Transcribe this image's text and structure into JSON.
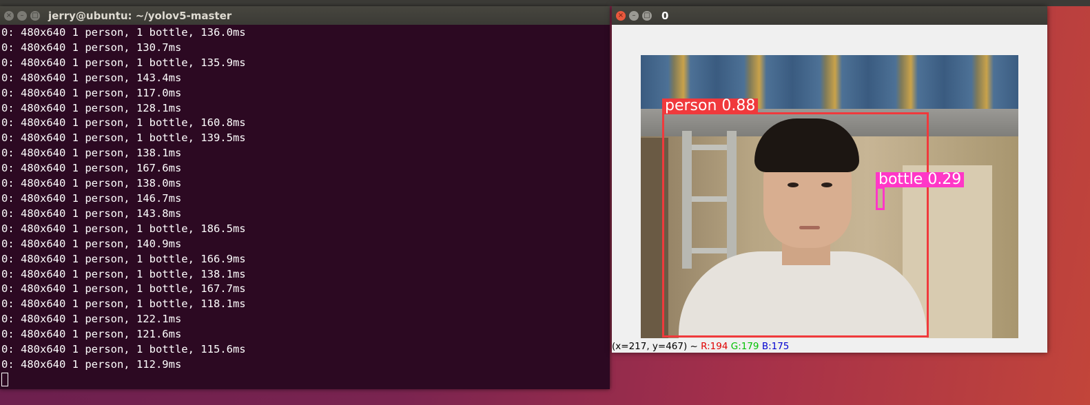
{
  "terminal": {
    "title": "jerry@ubuntu: ~/yolov5-master",
    "lines": [
      "0: 480x640 1 person, 1 bottle, 136.0ms",
      "0: 480x640 1 person, 130.7ms",
      "0: 480x640 1 person, 1 bottle, 135.9ms",
      "0: 480x640 1 person, 143.4ms",
      "0: 480x640 1 person, 117.0ms",
      "0: 480x640 1 person, 128.1ms",
      "0: 480x640 1 person, 1 bottle, 160.8ms",
      "0: 480x640 1 person, 1 bottle, 139.5ms",
      "0: 480x640 1 person, 138.1ms",
      "0: 480x640 1 person, 167.6ms",
      "0: 480x640 1 person, 138.0ms",
      "0: 480x640 1 person, 146.7ms",
      "0: 480x640 1 person, 143.8ms",
      "0: 480x640 1 person, 1 bottle, 186.5ms",
      "0: 480x640 1 person, 140.9ms",
      "0: 480x640 1 person, 1 bottle, 166.9ms",
      "0: 480x640 1 person, 1 bottle, 138.1ms",
      "0: 480x640 1 person, 1 bottle, 167.7ms",
      "0: 480x640 1 person, 1 bottle, 118.1ms",
      "0: 480x640 1 person, 122.1ms",
      "0: 480x640 1 person, 121.6ms",
      "0: 480x640 1 person, 1 bottle, 115.6ms",
      "0: 480x640 1 person, 112.9ms"
    ]
  },
  "viewer": {
    "title": "0",
    "detections": [
      {
        "label": "person 0.88",
        "color": "#f0393c"
      },
      {
        "label": "bottle 0.29",
        "color": "#ff37c7"
      }
    ],
    "status": {
      "coords": "(x=217, y=467) ~ ",
      "r": "R:194",
      "g": "G:179",
      "b": "B:175"
    }
  },
  "window_buttons": {
    "close": "×",
    "minimize": "–",
    "maximize": "□"
  }
}
